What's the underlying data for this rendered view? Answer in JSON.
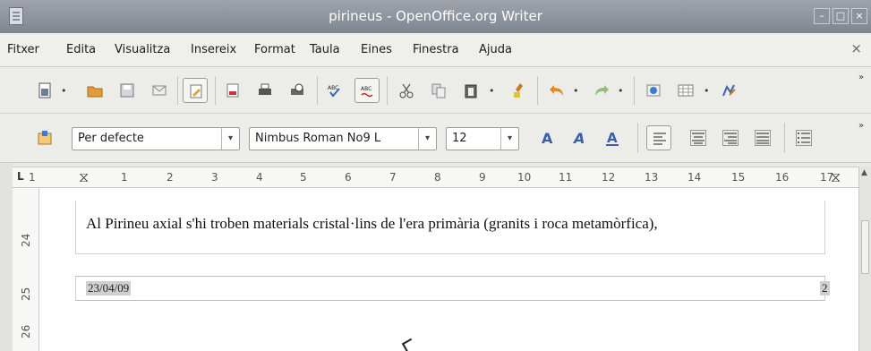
{
  "window": {
    "title": "pirineus - OpenOffice.org Writer"
  },
  "menu": [
    "Fitxer",
    "Edita",
    "Visualitza",
    "Insereix",
    "Format",
    "Taula",
    "Eines",
    "Finestra",
    "Ajuda"
  ],
  "format_bar": {
    "style": "Per defecte",
    "font": "Nimbus Roman No9 L",
    "size": "12"
  },
  "ruler": [
    "1",
    "1",
    "2",
    "3",
    "4",
    "5",
    "6",
    "7",
    "8",
    "9",
    "10",
    "11",
    "12",
    "13",
    "14",
    "15",
    "16",
    "17"
  ],
  "vruler": [
    "24",
    "25",
    "26"
  ],
  "document": {
    "body_text": "Al Pirineu axial s'hi troben materials cristal·lins de l'era primària (granits i roca metamòrfica),",
    "footer_date": "23/04/09",
    "footer_page": "2"
  }
}
